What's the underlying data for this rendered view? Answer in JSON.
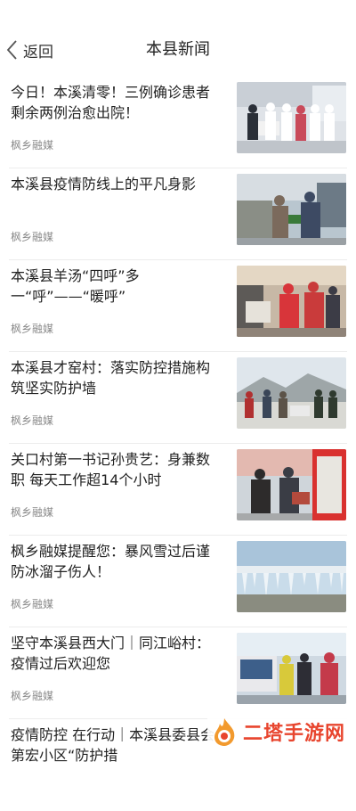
{
  "header": {
    "back_label": "返回",
    "title": "本县新闻"
  },
  "news": [
    {
      "headline": "今日！本溪清零！三例确诊患者剩余两例治愈出院！",
      "source": "枫乡融媒",
      "image": "hospital-staff-photo"
    },
    {
      "headline": "本溪县疫情防线上的平凡身影",
      "source": "枫乡融媒",
      "image": "checkpoint-volunteers-photo"
    },
    {
      "headline": "本溪县羊汤“四呼”多\n一“呼”——“暖呼”",
      "source": "枫乡融媒",
      "image": "soup-delivery-photo"
    },
    {
      "headline": "本溪县才窑村：落实防控措施构筑坚实防护墙",
      "source": "枫乡融媒",
      "image": "village-patrol-photo"
    },
    {
      "headline": "关口村第一书记孙贵艺：身兼数职 每天工作超14个小时",
      "source": "枫乡融媒",
      "image": "checkpoint-station-photo"
    },
    {
      "headline": "枫乡融媒提醒您：暴风雪过后谨防冰溜子伤人！",
      "source": "枫乡融媒",
      "image": "icicles-roof-photo"
    },
    {
      "headline": "坚守本溪县西大门｜同江峪村：疫情过后欢迎您",
      "source": "枫乡融媒",
      "image": "highway-checkpoint-photo"
    },
    {
      "headline": "疫情防控 在行动｜本溪县委县会第宏小区“防护措",
      "source": "",
      "image": ""
    }
  ],
  "watermark": {
    "text": "二塔手游网",
    "color": "#e8452e"
  },
  "colors": {
    "source": "#8a8a8a",
    "divider": "#ececec"
  }
}
